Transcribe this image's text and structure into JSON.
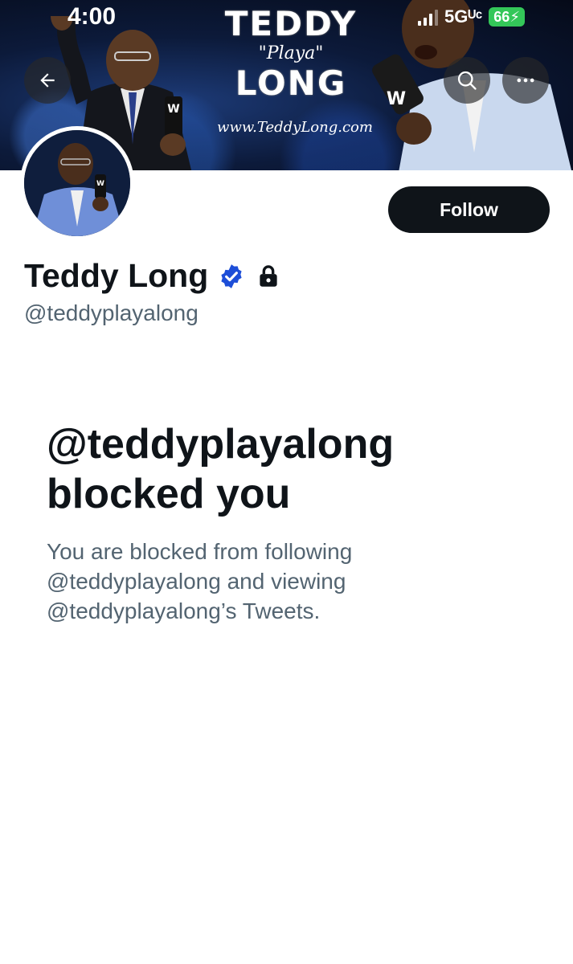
{
  "status_bar": {
    "time": "4:00",
    "network": "5Gᵁᶜ",
    "battery": "66"
  },
  "banner": {
    "title_line1": "TEDDY",
    "title_line2": "\"Playa\"",
    "title_line3": "LONG",
    "website": "www.TeddyLong.com"
  },
  "nav": {
    "back_icon": "arrow-left-icon",
    "search_icon": "search-icon",
    "more_icon": "more-horizontal-icon"
  },
  "profile": {
    "display_name": "Teddy Long",
    "handle": "@teddyplayalong",
    "follow_label": "Follow",
    "verified_color": "#1d4ed8",
    "icons": [
      "verified-badge-icon",
      "lock-icon"
    ]
  },
  "blocked": {
    "title": "@teddyplayalong blocked you",
    "description": "You are blocked from following @teddyplayalong and viewing @teddyplayalong’s Tweets."
  },
  "colors": {
    "text_primary": "#0f1419",
    "text_secondary": "#536471",
    "follow_bg": "#0f1419",
    "battery": "#34c759"
  }
}
